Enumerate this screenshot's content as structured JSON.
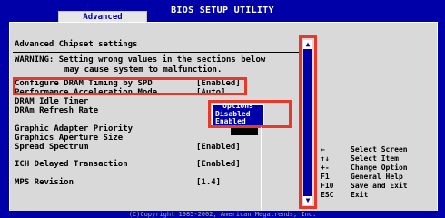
{
  "app": {
    "title": "BIOS SETUP UTILITY",
    "active_tab": "Advanced"
  },
  "settings": {
    "section_title": "Advanced Chipset settings",
    "warning_line1": "WARNING: Setting wrong values in the sections below",
    "warning_line2": "may cause system to malfunction.",
    "items": [
      {
        "label": "Configure DRAM Timing by SPD",
        "value": "[Enabled]"
      },
      {
        "label": "Performance Acceleration Mode",
        "value": "[Auto]"
      },
      {
        "label": "DRAM Idle Timer",
        "value": ""
      },
      {
        "label": "DRAm Refresh Rate",
        "value": ""
      },
      {
        "label": "Graphic Adapter Priority",
        "value": ""
      },
      {
        "label": "Graphics Aperture Size",
        "value": ""
      },
      {
        "label": "Spread Spectrum",
        "value": "[Enabled]"
      },
      {
        "label": "ICH Delayed Transaction",
        "value": "[Enabled]"
      },
      {
        "label": "MPS Revision",
        "value": "[1.4]"
      }
    ]
  },
  "popup": {
    "title": "Options",
    "options": [
      "Disabled",
      "Enabled"
    ],
    "selected": "Disabled"
  },
  "help": [
    {
      "key": "←",
      "desc": "Select Screen"
    },
    {
      "key": "↑↓",
      "desc": "Select Item"
    },
    {
      "key": "+-",
      "desc": "Change Option"
    },
    {
      "key": "F1",
      "desc": "General Help"
    },
    {
      "key": "F10",
      "desc": "Save and Exit"
    },
    {
      "key": "ESC",
      "desc": "Exit"
    }
  ],
  "footer": "(C)Copyright 1985-2002, American Megatrends, Inc.",
  "colors": {
    "bios_blue": "#0000a8",
    "panel_gray": "#d9d9d9",
    "highlight_red": "#e8382a"
  }
}
